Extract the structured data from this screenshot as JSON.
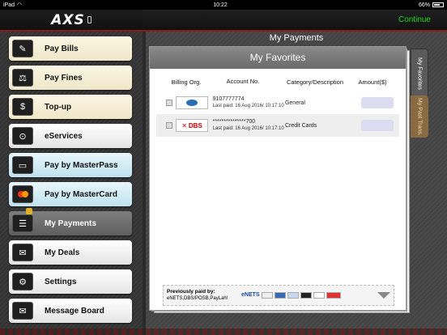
{
  "status_bar": {
    "device": "iPad",
    "time": "10:22",
    "battery": "66%"
  },
  "sidebar": {
    "logo": "AXS",
    "items": [
      {
        "label": "Pay Bills",
        "icon": "bill-icon",
        "glyph": "✎"
      },
      {
        "label": "Pay Fines",
        "icon": "gavel-icon",
        "glyph": "⚖"
      },
      {
        "label": "Top-up",
        "icon": "dollar-icon",
        "glyph": "$"
      },
      {
        "label": "eServices",
        "icon": "eservices-icon",
        "glyph": "⊙"
      },
      {
        "label": "Pay by MasterPass",
        "icon": "masterpass-icon",
        "glyph": "▭"
      },
      {
        "label": "Pay by MasterCard",
        "icon": "mastercard-icon",
        "glyph": ""
      },
      {
        "label": "My Payments",
        "icon": "my-payments-icon",
        "glyph": "☰"
      },
      {
        "label": "My Deals",
        "icon": "deals-icon",
        "glyph": "✉"
      },
      {
        "label": "Settings",
        "icon": "gear-icon",
        "glyph": "⚙"
      },
      {
        "label": "Message Board",
        "icon": "envelope-icon",
        "glyph": "✉"
      }
    ]
  },
  "header": {
    "continue_label": "Continue"
  },
  "main": {
    "page_title": "My Payments",
    "card_title": "My Favorites",
    "columns": [
      "Billing Org.",
      "Account No.",
      "Category/Description",
      "Amount($)"
    ],
    "rows": [
      {
        "org": "Standard Chartered",
        "account": "9107777774",
        "last_paid": "Last paid: 16 Aug 2016/ 10:17:10",
        "category": "General"
      },
      {
        "org": "DBS",
        "account": "***************700",
        "last_paid": "Last paid: 16 Aug 2016/ 10:17:10",
        "category": "Credit Cards"
      }
    ],
    "footer": {
      "previously_label": "Previously paid by:",
      "methods": "eNETS,DBS/POSB,PayLah!",
      "enets_logo": "eNETS"
    },
    "tabs": [
      "My Favorites",
      "My Past Trans."
    ]
  },
  "colors": {
    "accent_green": "#1fdc1f",
    "accent_red": "#8b1a1a"
  }
}
